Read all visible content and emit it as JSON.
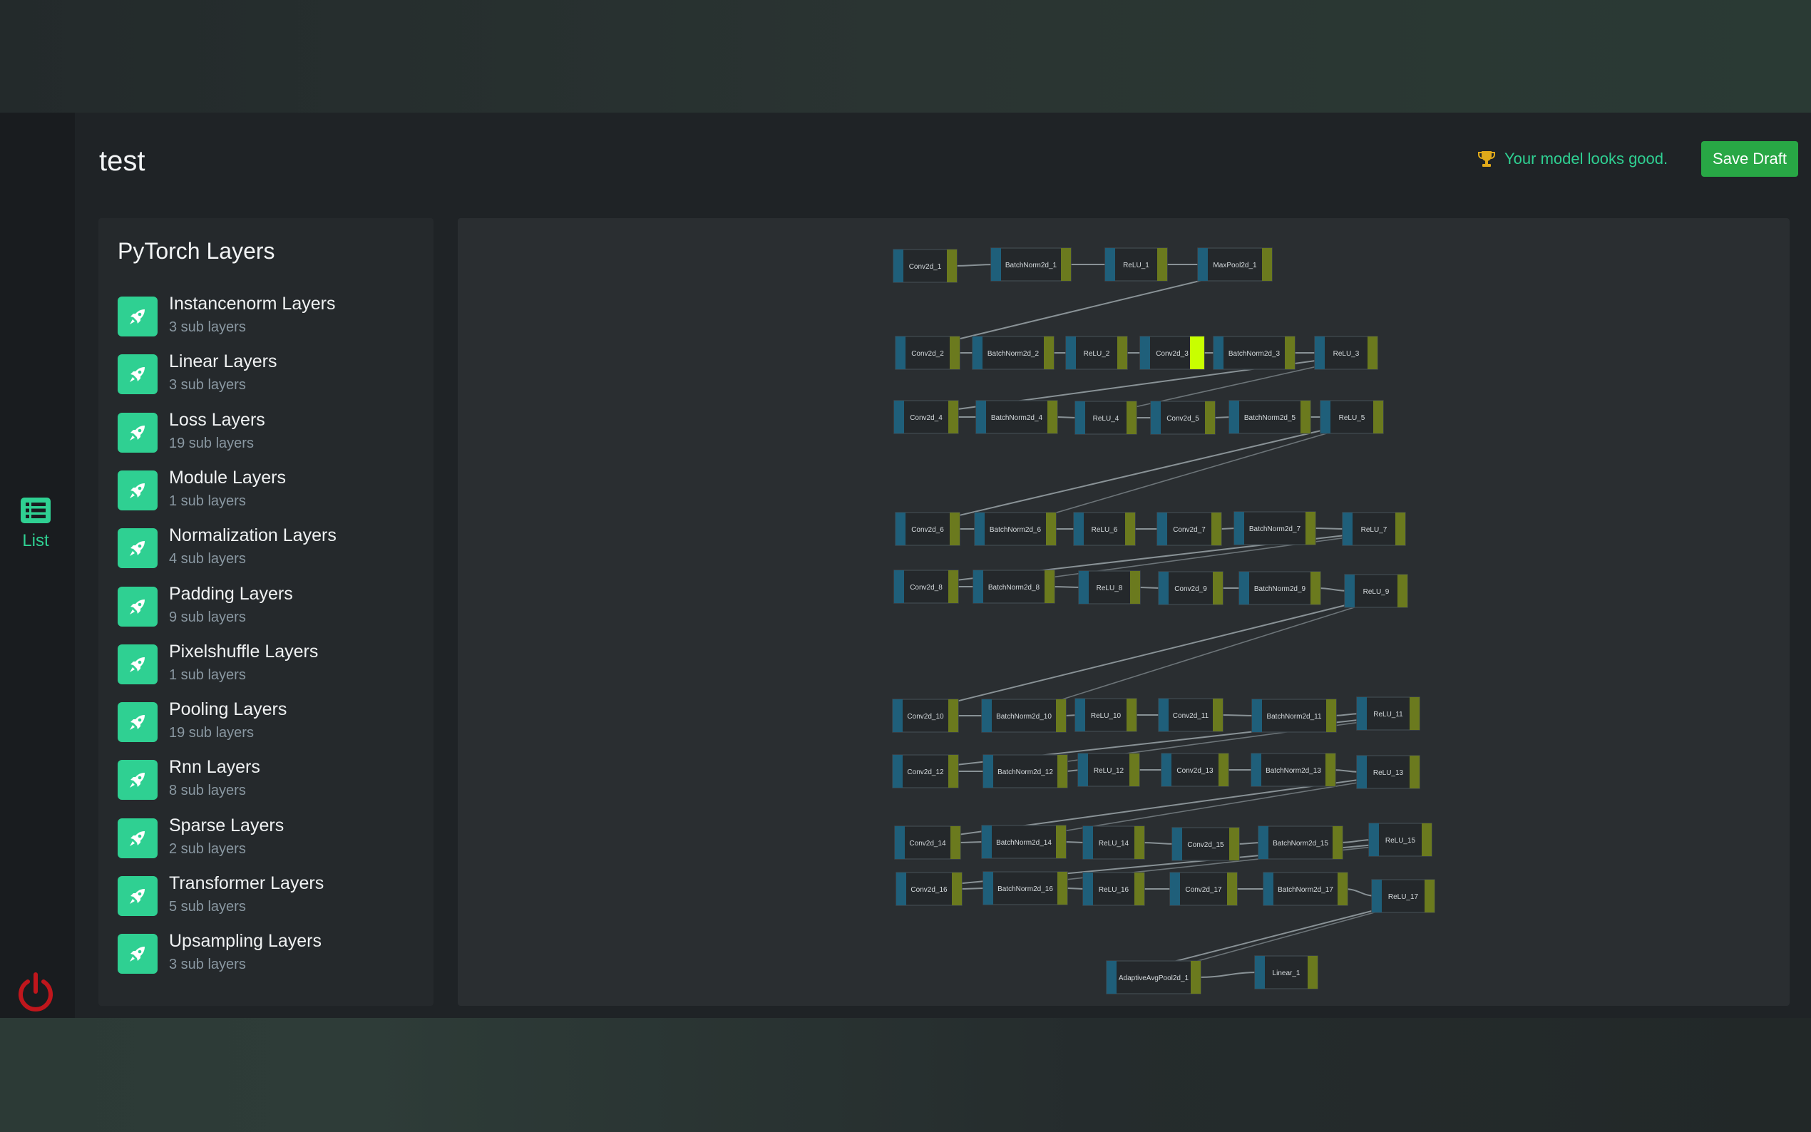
{
  "page": {
    "title": "test"
  },
  "nav": {
    "list_label": "List"
  },
  "status": {
    "message": "Your model looks good."
  },
  "toolbar": {
    "save_label": "Save Draft"
  },
  "layers": {
    "title": "PyTorch Layers",
    "items": [
      {
        "name": "Instancenorm Layers",
        "sub": "3 sub layers"
      },
      {
        "name": "Linear Layers",
        "sub": "3 sub layers"
      },
      {
        "name": "Loss Layers",
        "sub": "19 sub layers"
      },
      {
        "name": "Module Layers",
        "sub": "1 sub layers"
      },
      {
        "name": "Normalization Layers",
        "sub": "4 sub layers"
      },
      {
        "name": "Padding Layers",
        "sub": "9 sub layers"
      },
      {
        "name": "Pixelshuffle Layers",
        "sub": "1 sub layers"
      },
      {
        "name": "Pooling Layers",
        "sub": "19 sub layers"
      },
      {
        "name": "Rnn Layers",
        "sub": "8 sub layers"
      },
      {
        "name": "Sparse Layers",
        "sub": "2 sub layers"
      },
      {
        "name": "Transformer Layers",
        "sub": "5 sub layers"
      },
      {
        "name": "Upsampling Layers",
        "sub": "3 sub layers"
      }
    ]
  },
  "graph": {
    "nodes": [
      "Conv2d_1",
      "BatchNorm2d_1",
      "ReLU_1",
      "MaxPool2d_1",
      "Conv2d_2",
      "BatchNorm2d_2",
      "ReLU_2",
      "Conv2d_3",
      "BatchNorm2d_3",
      "ReLU_3",
      "Conv2d_4",
      "BatchNorm2d_4",
      "ReLU_4",
      "Conv2d_5",
      "BatchNorm2d_5",
      "ReLU_5",
      "Conv2d_6",
      "BatchNorm2d_6",
      "ReLU_6",
      "Conv2d_7",
      "BatchNorm2d_7",
      "ReLU_7",
      "Conv2d_8",
      "BatchNorm2d_8",
      "ReLU_8",
      "Conv2d_9",
      "BatchNorm2d_9",
      "ReLU_9",
      "Conv2d_10",
      "BatchNorm2d_10",
      "ReLU_10",
      "Conv2d_11",
      "BatchNorm2d_11",
      "ReLU_11",
      "Conv2d_12",
      "BatchNorm2d_12",
      "ReLU_12",
      "Conv2d_13",
      "BatchNorm2d_13",
      "ReLU_13",
      "Conv2d_14",
      "BatchNorm2d_14",
      "ReLU_14",
      "Conv2d_15",
      "BatchNorm2d_15",
      "ReLU_15",
      "Conv2d_16",
      "BatchNorm2d_16",
      "ReLU_16",
      "Conv2d_17",
      "BatchNorm2d_17",
      "ReLU_17",
      "AdaptiveAvgPool2d_1",
      "Linear_1"
    ],
    "selected_node": "Conv2d_3",
    "colors": {
      "input_port": "#1f5f7a",
      "output_port": "#6b7a1e",
      "selected_port": "#c8ff00",
      "edge": "#9aa3a8"
    }
  },
  "colors": {
    "accent": "#2fd092",
    "save_button": "#28a745",
    "power": "#c0161c"
  },
  "icons": {
    "nav": "list-icon",
    "status": "trophy-icon",
    "layer": "rocket-icon",
    "logout": "power-icon"
  }
}
